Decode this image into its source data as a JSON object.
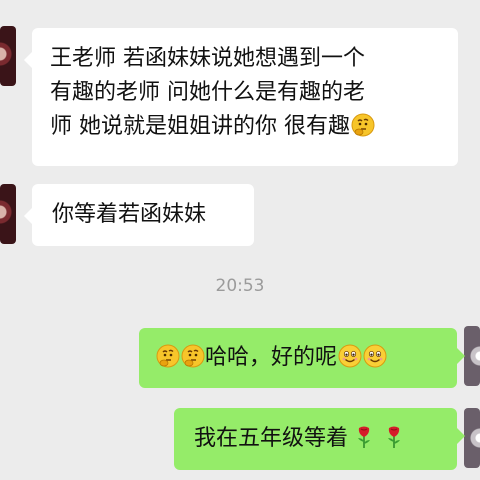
{
  "messages": [
    {
      "direction": "incoming",
      "lines": [
        "王老师 若函妹妹说她想遇到一个",
        "有趣的老师 问她什么是有趣的老",
        "师 她说就是姐姐讲的你 很有趣"
      ],
      "trailing_emoji": [
        "thinking-face-icon"
      ]
    },
    {
      "direction": "incoming",
      "text": "你等着若函妹妹"
    },
    {
      "direction": "timestamp",
      "text": "20:53"
    },
    {
      "direction": "outgoing",
      "leading_emoji": [
        "thinking-face-icon",
        "thinking-face-icon"
      ],
      "text": "哈哈，好的呢",
      "trailing_emoji": [
        "smiling-face-icon",
        "smiling-face-icon"
      ]
    },
    {
      "direction": "outgoing",
      "text": "我在五年级等着",
      "trailing_emoji": [
        "rose-icon",
        "rose-icon"
      ]
    }
  ],
  "colors": {
    "background": "#ececec",
    "incoming_bubble": "#ffffff",
    "outgoing_bubble": "#95ec69",
    "timestamp": "#9b9b9b"
  }
}
